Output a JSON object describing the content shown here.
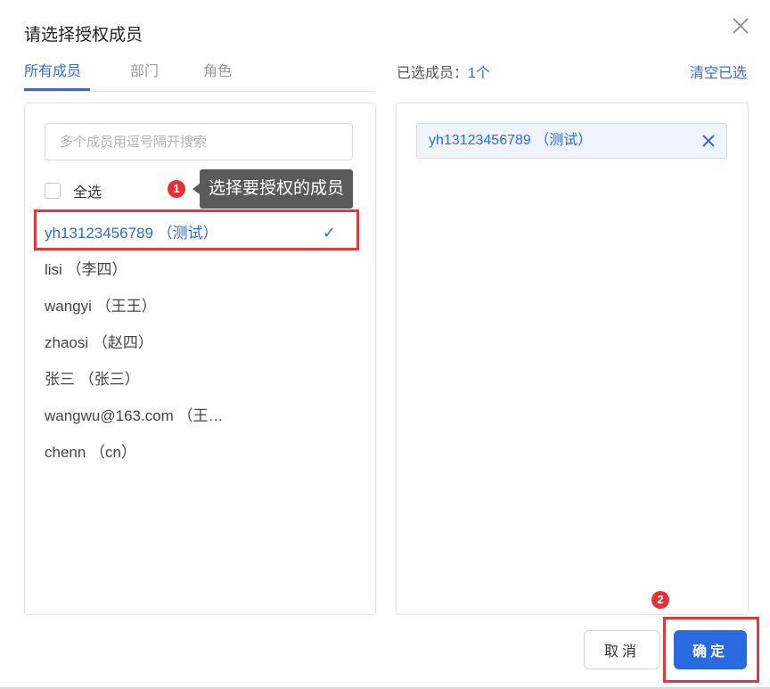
{
  "dialog": {
    "title": "请选择授权成员",
    "close_icon": "close-icon"
  },
  "tabs": [
    {
      "label": "所有成员",
      "active": true
    },
    {
      "label": "部门",
      "active": false
    },
    {
      "label": "角色",
      "active": false
    }
  ],
  "selected_header": {
    "prefix": "已选成员：",
    "count": "1个",
    "clear_label": "清空已选"
  },
  "search": {
    "placeholder": "多个成员用逗号隔开搜索",
    "value": ""
  },
  "select_all_label": "全选",
  "members": [
    {
      "label": "yh13123456789 （测试）",
      "selected": true
    },
    {
      "label": "lisi （李四）",
      "selected": false
    },
    {
      "label": "wangyi （王王）",
      "selected": false
    },
    {
      "label": "zhaosi （赵四）",
      "selected": false
    },
    {
      "label": "张三 （张三）",
      "selected": false
    },
    {
      "label": "wangwu@163.com （王…",
      "selected": false
    },
    {
      "label": "chenn （cn）",
      "selected": false
    }
  ],
  "selected_tags": [
    {
      "label": "yh13123456789 （测试）"
    }
  ],
  "buttons": {
    "cancel": "取消",
    "ok": "确定"
  },
  "annotations": {
    "step1_badge": "1",
    "step1_tooltip": "选择要授权的成员",
    "step2_badge": "2"
  },
  "colors": {
    "accent": "#2f6bd9",
    "primary_button": "#2a6ae0",
    "annotation_red": "#e0393d",
    "tooltip_bg": "#5a5a5a"
  }
}
